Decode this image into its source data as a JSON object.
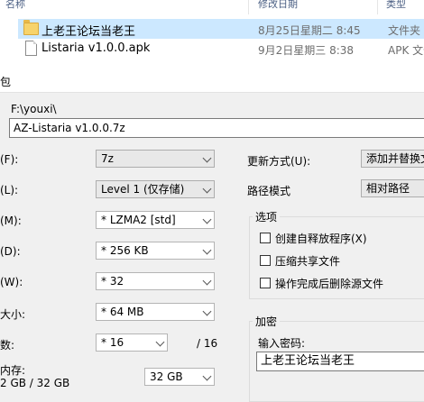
{
  "explorer": {
    "columns": {
      "name": "名称",
      "date": "修改日期",
      "type": "类型"
    },
    "files": [
      {
        "name": "上老王论坛当老王",
        "date": "8月25日星期二 8:45",
        "type": "文件夹",
        "icon": "folder-icon",
        "selected": true
      },
      {
        "name": "Listaria v1.0.0.apk",
        "date": "9月2日星期三 8:38",
        "type": "APK 文件",
        "icon": "file-icon",
        "selected": false
      }
    ]
  },
  "dialog": {
    "title": "包",
    "archive_path": "F:\\youxi\\",
    "archive_name": "AZ-Listaria v1.0.0.7z",
    "format": {
      "label": "(F):",
      "value": "7z"
    },
    "level": {
      "label": "(L):",
      "value": "Level 1 (仅存储)"
    },
    "method": {
      "label": "(M):",
      "value": "* LZMA2 [std]"
    },
    "dictionary": {
      "label": "(D):",
      "value": "* 256 KB"
    },
    "word": {
      "label": "(W):",
      "value": "* 32"
    },
    "solid": {
      "label": "大小:",
      "value": "* 64 MB"
    },
    "threads": {
      "label": "数:",
      "value": "* 16",
      "max": "/ 16"
    },
    "memory": {
      "label": "内存:",
      "usage": "2 GB / 32 GB",
      "value": "32 GB"
    },
    "update_mode": {
      "label": "更新方式(U):",
      "value": "添加并替换文"
    },
    "path_mode": {
      "label": "路径模式",
      "value": "相对路径"
    },
    "options": {
      "title": "选项",
      "sfx": "创建自释放程序(X)",
      "shared": "压缩共享文件",
      "delete": "操作完成后删除源文件"
    },
    "encryption": {
      "title": "加密",
      "label": "输入密码:",
      "value": "上老王论坛当老王"
    }
  }
}
